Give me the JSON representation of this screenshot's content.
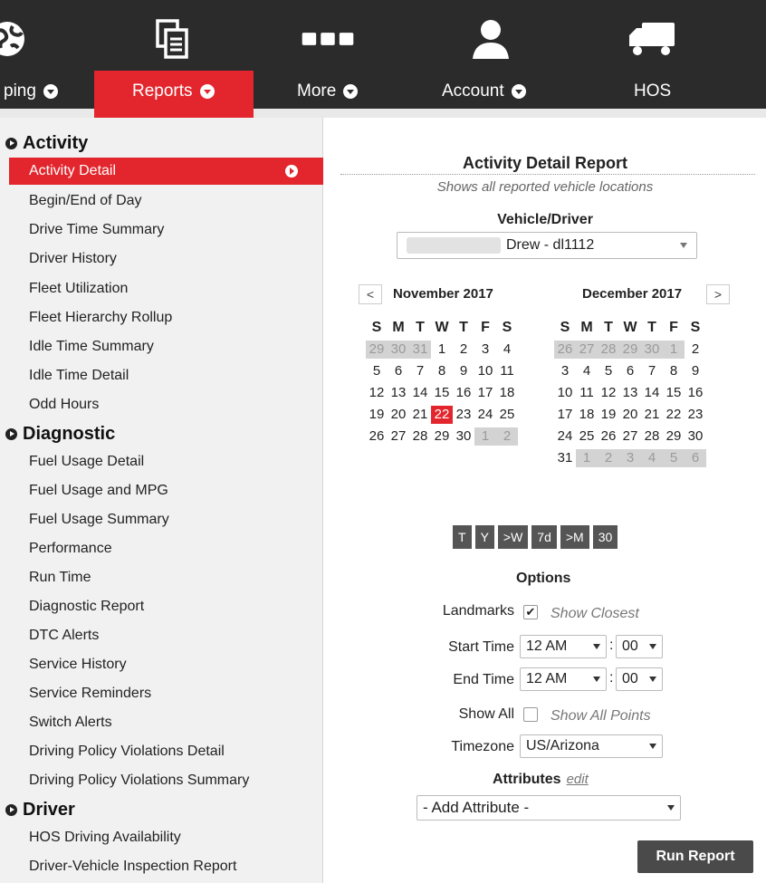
{
  "nav": {
    "tabs": [
      {
        "label": "ping",
        "icon": "globe-icon"
      },
      {
        "label": "Reports",
        "icon": "reports-icon"
      },
      {
        "label": "More",
        "icon": "more-icon"
      },
      {
        "label": "Account",
        "icon": "user-icon"
      },
      {
        "label": "HOS",
        "icon": "truck-icon"
      }
    ],
    "active_color": "#e3262d"
  },
  "menu": {
    "sections": [
      {
        "title": "Activity",
        "items": [
          "Activity Detail",
          "Begin/End of Day",
          "Drive Time Summary",
          "Driver History",
          "Fleet Utilization",
          "Fleet Hierarchy Rollup",
          "Idle Time Summary",
          "Idle Time Detail",
          "Odd Hours"
        ]
      },
      {
        "title": "Diagnostic",
        "items": [
          "Fuel Usage Detail",
          "Fuel Usage and MPG",
          "Fuel Usage Summary",
          "Performance",
          "Run Time",
          "Diagnostic Report",
          "DTC Alerts",
          "Service History",
          "Service Reminders",
          "Switch Alerts",
          "Driving Policy Violations Detail",
          "Driving Policy Violations Summary"
        ]
      },
      {
        "title": "Driver",
        "items": [
          "HOS Driving Availability",
          "Driver-Vehicle Inspection Report"
        ]
      }
    ],
    "active_item": "Activity Detail"
  },
  "report": {
    "title": "Activity Detail Report",
    "subtitle": "Shows all reported vehicle locations",
    "vehicle_label": "Vehicle/Driver",
    "vehicle_value": "Drew - dl1112",
    "cal_left": {
      "nav": "<",
      "month": "November 2017",
      "headers": [
        "S",
        "M",
        "T",
        "W",
        "T",
        "F",
        "S"
      ],
      "days": [
        [
          "29",
          "30",
          "31",
          "1",
          "2",
          "3",
          "4"
        ],
        [
          "5",
          "6",
          "7",
          "8",
          "9",
          "10",
          "11"
        ],
        [
          "12",
          "13",
          "14",
          "15",
          "16",
          "17",
          "18"
        ],
        [
          "19",
          "20",
          "21",
          "22",
          "23",
          "24",
          "25"
        ],
        [
          "26",
          "27",
          "28",
          "29",
          "30",
          "1",
          "2"
        ]
      ],
      "today": "22"
    },
    "cal_right": {
      "nav": ">",
      "month": "December 2017",
      "headers": [
        "S",
        "M",
        "T",
        "W",
        "T",
        "F",
        "S"
      ],
      "days": [
        [
          "26",
          "27",
          "28",
          "29",
          "30",
          "1",
          "2"
        ],
        [
          "3",
          "4",
          "5",
          "6",
          "7",
          "8",
          "9"
        ],
        [
          "10",
          "11",
          "12",
          "13",
          "14",
          "15",
          "16"
        ],
        [
          "17",
          "18",
          "19",
          "20",
          "21",
          "22",
          "23"
        ],
        [
          "24",
          "25",
          "26",
          "27",
          "28",
          "29",
          "30"
        ],
        [
          "31",
          "1",
          "2",
          "3",
          "4",
          "5",
          "6"
        ]
      ]
    },
    "quick_ranges": [
      "T",
      "Y",
      ">W",
      "7d",
      ">M",
      "30"
    ],
    "options_label": "Options",
    "landmarks_label": "Landmarks",
    "show_closest": "Show Closest",
    "start_time_label": "Start Time",
    "start_hour": "12 AM",
    "start_min": "00",
    "end_time_label": "End Time",
    "end_hour": "12 AM",
    "end_min": "00",
    "show_all_label": "Show All",
    "show_all_points": "Show All Points",
    "timezone_label": "Timezone",
    "timezone_value": "US/Arizona",
    "attributes_label": "Attributes",
    "attributes_edit": "edit",
    "add_attribute": "- Add Attribute -",
    "run_report": "Run Report",
    "colon": ":"
  }
}
